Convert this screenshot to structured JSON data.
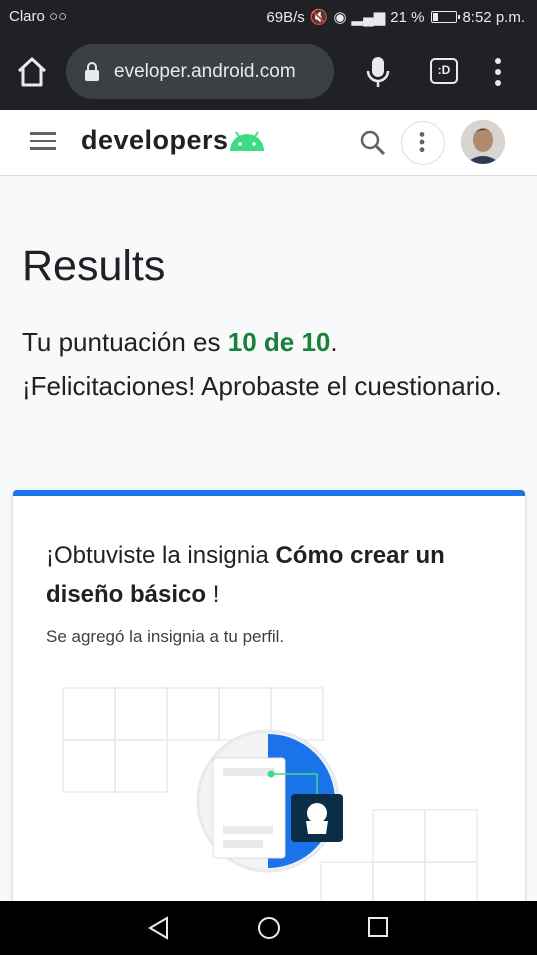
{
  "status_bar": {
    "carrier": "Claro",
    "voicemail_icon": "voicemail-icon",
    "net_speed": "69B/s",
    "battery_percent": "21 %",
    "battery_level": 0.21,
    "time": "8:52 p.m."
  },
  "browser": {
    "url": "eveloper.android.com",
    "tab_count": ":D"
  },
  "site": {
    "brand": "developers"
  },
  "results": {
    "title": "Results",
    "score_prefix": "Tu puntuación es ",
    "score_value": "10 de 10",
    "score_suffix": ". ¡Felicitaciones! Aprobaste el cuestionario."
  },
  "badge": {
    "heading_prefix": "¡Obtuviste la insignia ",
    "heading_name": "Cómo crear un diseño básico",
    "heading_suffix": " !",
    "subtitle": "Se agregó la insignia a tu perfil."
  },
  "colors": {
    "accent_blue": "#1a73e8",
    "score_green": "#188038",
    "android_green": "#3ddc84"
  }
}
